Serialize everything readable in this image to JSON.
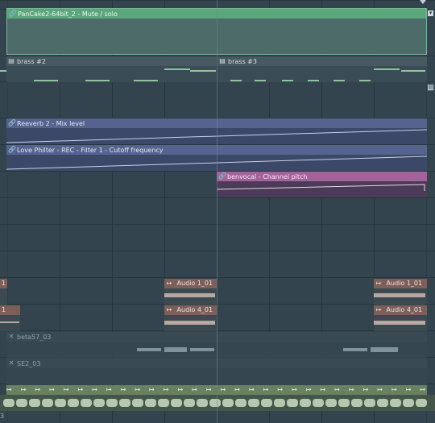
{
  "clips": {
    "pancake": {
      "label": "PanCake2-64bit_2 - Mute / solo"
    },
    "brass2": {
      "label": "brass #2"
    },
    "brass3": {
      "label": "brass #3"
    },
    "reeverb": {
      "label": "Reeverb 2 - Mix level"
    },
    "lovephilter": {
      "label": "Love Philter - REC - Filter 1 - Cutoff frequency"
    },
    "benvocal": {
      "label": "benvocal - Channel pitch"
    },
    "audio1_left": {
      "label": "1"
    },
    "audio1_mid": {
      "label": "Audio 1_01"
    },
    "audio1_right": {
      "label": "Audio 1_01"
    },
    "audio4_left": {
      "label": "1"
    },
    "audio4_mid": {
      "label": "Audio 4_01"
    },
    "audio4_right": {
      "label": "Audio 4_01"
    },
    "beta57": {
      "label": "beta57_03"
    },
    "se2": {
      "label": "SE2_03"
    },
    "bottom_left": {
      "label": "3"
    }
  },
  "icons": {
    "automation": "🔗",
    "pattern": "▤",
    "audio": "↦",
    "muted": "✕"
  },
  "colors": {
    "background": "#34444e",
    "mute_clip": "#5aa77b",
    "automation_blue": "#57638f",
    "automation_pink": "#a2639a",
    "audio_tag": "#7b5f58",
    "playhead": "#6d8792"
  }
}
